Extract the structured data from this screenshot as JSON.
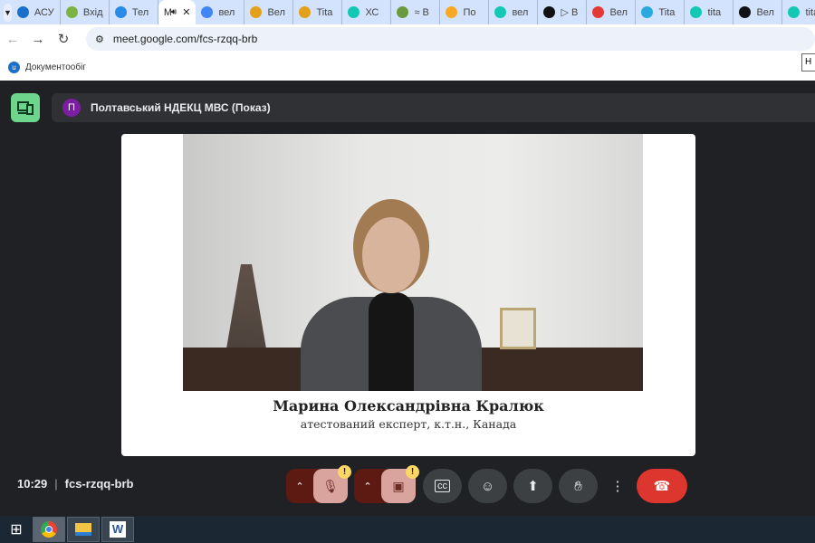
{
  "browser": {
    "tabs": [
      {
        "label": "АСУ",
        "color": "#1a6fc9"
      },
      {
        "label": "Вхід",
        "color": "#7cb342"
      },
      {
        "label": "Тел",
        "color": "#2b8ae6"
      },
      {
        "label": "М",
        "color": "#ffffff",
        "active": true
      },
      {
        "label": "вел",
        "color": "#4285f4"
      },
      {
        "label": "Вел",
        "color": "#e3a01b"
      },
      {
        "label": "Tita",
        "color": "#e3a01b"
      },
      {
        "label": "ХС",
        "color": "#14c9b4"
      },
      {
        "label": "≈ В",
        "color": "#6a9b3e"
      },
      {
        "label": "По",
        "color": "#f9a825"
      },
      {
        "label": "вел",
        "color": "#14c9b4"
      },
      {
        "label": "▷ В",
        "color": "#111111"
      },
      {
        "label": "Вел",
        "color": "#e53935"
      },
      {
        "label": "Tita",
        "color": "#29a9e0"
      },
      {
        "label": "tita",
        "color": "#14c9b4"
      },
      {
        "label": "Вел",
        "color": "#111111"
      },
      {
        "label": "tita",
        "color": "#14c9b4"
      }
    ],
    "url": "meet.google.com/fcs-rzqq-brb",
    "bookmark": "Документообіг",
    "tooltip": "Н"
  },
  "meet": {
    "avatar_letter": "П",
    "presenter_title": "Полтавський НДЕКЦ МВС (Показ)",
    "speaker_name": "Марина Олександрівна Кралюк",
    "speaker_role": "атестований експерт, к.т.н., Канада",
    "time": "10:29",
    "meeting_code": "fcs-rzqq-brb",
    "warning_badge": "!",
    "colors": {
      "end_call": "#dc362e",
      "muted": "#d9a49e",
      "devices": "#6dd58c"
    }
  }
}
